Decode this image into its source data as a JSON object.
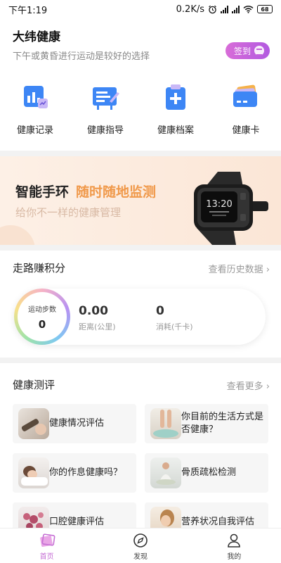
{
  "status_bar": {
    "time": "下午1:19",
    "net_speed": "0.2K/s",
    "battery": "68"
  },
  "header": {
    "brand": "大纬健康",
    "tip": "下午或黄昏进行运动是较好的选择",
    "checkin_label": "签到"
  },
  "features": [
    {
      "label": "健康记录",
      "icon": "health-record-icon"
    },
    {
      "label": "健康指导",
      "icon": "health-guide-icon"
    },
    {
      "label": "健康档案",
      "icon": "health-file-icon"
    },
    {
      "label": "健康卡",
      "icon": "health-card-icon"
    }
  ],
  "banner": {
    "title": "智能手环",
    "highlight": "随时随地监测",
    "subtitle": "给你不一样的健康管理",
    "watch_time": "13:20"
  },
  "walk": {
    "title": "走路赚积分",
    "more": "查看历史数据",
    "steps_label": "运动步数",
    "steps": "0",
    "distance": "0.00",
    "distance_label": "距离(公里)",
    "calories": "0",
    "calories_label": "消耗(千卡)"
  },
  "assessment": {
    "title": "健康测评",
    "more": "查看更多",
    "items": [
      {
        "label": "健康情况评估"
      },
      {
        "label": "你目前的生活方式是否健康？"
      },
      {
        "label": "你的作息健康吗？"
      },
      {
        "label": "骨质疏松检测"
      },
      {
        "label": "口腔健康评估"
      },
      {
        "label": "营养状况自我评估"
      }
    ]
  },
  "tabbar": [
    {
      "label": "首页",
      "active": true
    },
    {
      "label": "发现",
      "active": false
    },
    {
      "label": "我的",
      "active": false
    }
  ],
  "colors": {
    "accent": "#c56fd4",
    "banner_highlight": "#f0994a",
    "icon_blue": "#3d86f5"
  }
}
